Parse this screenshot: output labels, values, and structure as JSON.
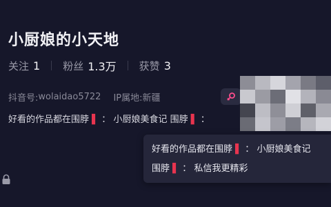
{
  "profile": {
    "name": "小厨娘的小天地",
    "stats": [
      {
        "label": "关注",
        "value": "1"
      },
      {
        "label": "粉丝",
        "value": "1.3万"
      },
      {
        "label": "获赞",
        "value": "3"
      }
    ],
    "douyin_id_label": "抖音号:",
    "douyin_id": "wolaidao5722",
    "ip_label": "IP属地:",
    "ip_value": "新疆",
    "bio_part1": "好看的作品都在围脖",
    "bio_sep": "：",
    "bio_part2": "小厨娘美食记 围脖",
    "bio_tail": "："
  },
  "tooltip": {
    "line1_part1": "好看的作品都在围脖",
    "line1_sep": "：",
    "line1_part2": "小厨娘美食记",
    "line2_part1": "围脖",
    "line2_sep": "：",
    "line2_part2": "私信我更精彩"
  },
  "icons": {
    "pin": "▌",
    "badge": "female-icon",
    "lock": "lock-icon"
  },
  "colors": {
    "background": "#16172a",
    "accent_pink": "#ff4d8d",
    "pin_red": "#e8344f"
  }
}
